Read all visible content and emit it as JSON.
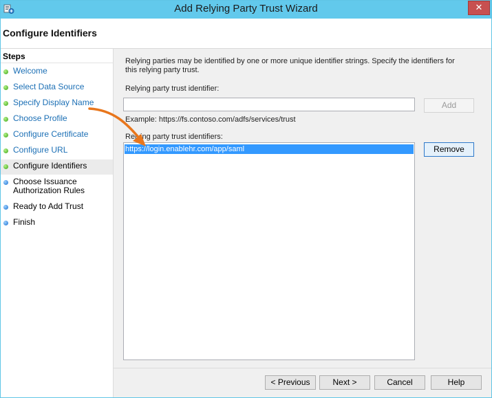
{
  "window": {
    "title": "Add Relying Party Trust Wizard",
    "icon": "adfs-wizard-icon",
    "close_glyph": "✕"
  },
  "header": {
    "title": "Configure Identifiers"
  },
  "steps": {
    "title": "Steps",
    "items": [
      {
        "label": "Welcome",
        "status": "complete",
        "dot_color": "green"
      },
      {
        "label": "Select Data Source",
        "status": "complete",
        "dot_color": "green"
      },
      {
        "label": "Specify Display Name",
        "status": "complete",
        "dot_color": "green"
      },
      {
        "label": "Choose Profile",
        "status": "complete",
        "dot_color": "green"
      },
      {
        "label": "Configure Certificate",
        "status": "complete",
        "dot_color": "green"
      },
      {
        "label": "Configure URL",
        "status": "complete",
        "dot_color": "green"
      },
      {
        "label": "Configure Identifiers",
        "status": "current",
        "dot_color": "green"
      },
      {
        "label_line1": "Choose Issuance",
        "label_line2": "Authorization Rules",
        "status": "pending",
        "dot_color": "blue"
      },
      {
        "label": "Ready to Add Trust",
        "status": "pending",
        "dot_color": "blue"
      },
      {
        "label": "Finish",
        "status": "pending",
        "dot_color": "blue"
      }
    ]
  },
  "main": {
    "description": "Relying parties may be identified by one or more unique identifier strings. Specify the identifiers for this relying party trust.",
    "identifier_label": "Relying party trust identifier:",
    "identifier_value": "",
    "add_label": "Add",
    "example": "Example: https://fs.contoso.com/adfs/services/trust",
    "list_label": "Relying party trust identifiers:",
    "identifiers": [
      "https://login.enablehr.com/app/saml"
    ],
    "remove_label": "Remove"
  },
  "footer": {
    "previous_label": "< Previous",
    "next_label": "Next >",
    "cancel_label": "Cancel",
    "help_label": "Help"
  },
  "colors": {
    "titlebar": "#62c9ec",
    "link": "#1b6fb5",
    "selection": "#3399ff",
    "annotation_arrow": "#e8761c"
  }
}
